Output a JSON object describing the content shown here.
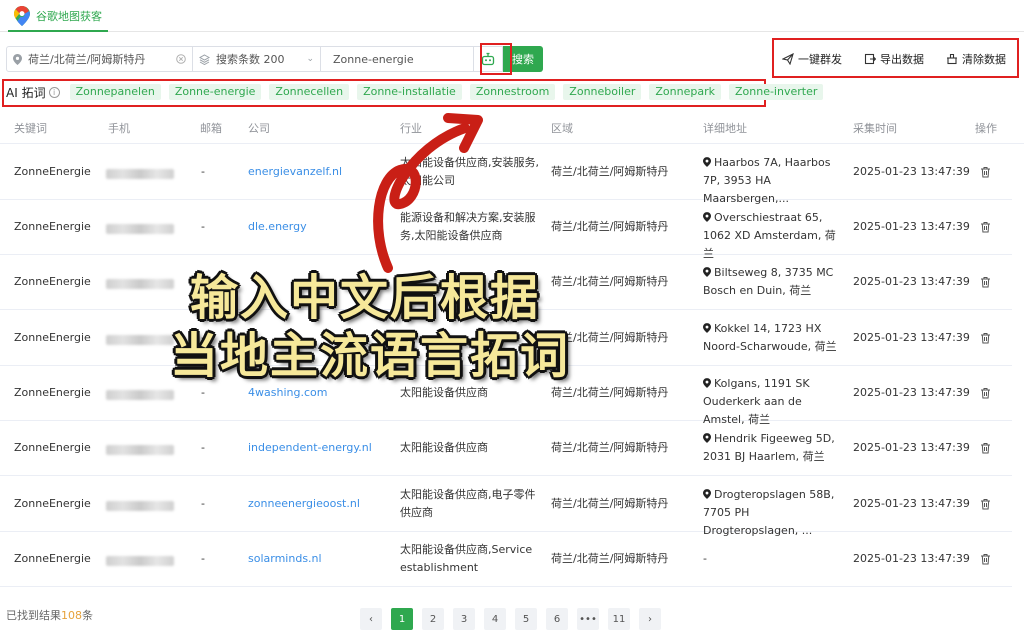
{
  "app": {
    "title": "谷歌地图获客"
  },
  "search": {
    "location": "荷兰/北荷兰/阿姆斯特丹",
    "count": "搜索条数 200",
    "keyword": "Zonne-energie",
    "button": "搜索"
  },
  "actions": [
    {
      "label": "一键群发",
      "icon": "send-icon"
    },
    {
      "label": "导出数据",
      "icon": "export-icon"
    },
    {
      "label": "清除数据",
      "icon": "clear-icon"
    }
  ],
  "ai": {
    "label": "AI 拓词",
    "tags": [
      "Zonnepanelen",
      "Zonne-energie",
      "Zonnecellen",
      "Zonne-installatie",
      "Zonnestroom",
      "Zonneboiler",
      "Zonnepark",
      "Zonne-inverter"
    ]
  },
  "table": {
    "headers": [
      "关键词",
      "手机",
      "邮箱",
      "公司",
      "行业",
      "区域",
      "详细地址",
      "采集时间",
      "操作"
    ],
    "rows": [
      {
        "keyword": "ZonneEnergie",
        "email": "-",
        "company": "energievanzelf.nl",
        "industry": "太阳能设备供应商,安装服务,太阳能公司",
        "region": "荷兰/北荷兰/阿姆斯特丹",
        "address": "Haarbos 7A, Haarbos 7P, 3953 HA Maarsbergen,...",
        "time": "2025-01-23 13:47:39"
      },
      {
        "keyword": "ZonneEnergie",
        "email": "-",
        "company": "dle.energy",
        "industry": "能源设备和解决方案,安装服务,太阳能设备供应商",
        "region": "荷兰/北荷兰/阿姆斯特丹",
        "address": "Overschiestraat 65, 1062 XD Amsterdam, 荷兰",
        "time": "2025-01-23 13:47:39"
      },
      {
        "keyword": "ZonneEnergie",
        "email": "-",
        "company": "",
        "industry": "",
        "region": "荷兰/北荷兰/阿姆斯特丹",
        "address": "Biltseweg 8, 3735 MC Bosch en Duin, 荷兰",
        "time": "2025-01-23 13:47:39"
      },
      {
        "keyword": "ZonneEnergie",
        "email": "-",
        "company": "",
        "industry": "",
        "region": "荷兰/北荷兰/阿姆斯特丹",
        "address": "Kokkel 14, 1723 HX Noord-Scharwoude, 荷兰",
        "time": "2025-01-23 13:47:39"
      },
      {
        "keyword": "ZonneEnergie",
        "email": "-",
        "company": "4washing.com",
        "industry": "太阳能设备供应商",
        "region": "荷兰/北荷兰/阿姆斯特丹",
        "address": "Kolgans, 1191 SK Ouderkerk aan de Amstel, 荷兰",
        "time": "2025-01-23 13:47:39"
      },
      {
        "keyword": "ZonneEnergie",
        "email": "-",
        "company": "independent-energy.nl",
        "industry": "太阳能设备供应商",
        "region": "荷兰/北荷兰/阿姆斯特丹",
        "address": "Hendrik Figeeweg 5D, 2031 BJ Haarlem, 荷兰",
        "time": "2025-01-23 13:47:39"
      },
      {
        "keyword": "ZonneEnergie",
        "email": "-",
        "company": "zonneenergieoost.nl",
        "industry": "太阳能设备供应商,电子零件供应商",
        "region": "荷兰/北荷兰/阿姆斯特丹",
        "address": "Drogteropslagen 58B, 7705 PH Drogteropslagen, ...",
        "time": "2025-01-23 13:47:39"
      },
      {
        "keyword": "ZonneEnergie",
        "email": "-",
        "company": "solarminds.nl",
        "industry": "太阳能设备供应商,Service establishment",
        "region": "荷兰/北荷兰/阿姆斯特丹",
        "address": "-",
        "time": "2025-01-23 13:47:39"
      }
    ]
  },
  "overlay": {
    "line1": "输入中文后根据",
    "line2": "当地主流语言拓词"
  },
  "footer": {
    "prefix": "已找到结果",
    "count": "108",
    "suffix": "条"
  },
  "pagination": {
    "prev": "‹",
    "pages": [
      "1",
      "2",
      "3",
      "4",
      "5",
      "6",
      "•••",
      "11"
    ],
    "next": "›",
    "current": "1"
  },
  "colors": {
    "accent": "#2fa84f",
    "link": "#3a8ee6",
    "highlight": "#e02020"
  }
}
